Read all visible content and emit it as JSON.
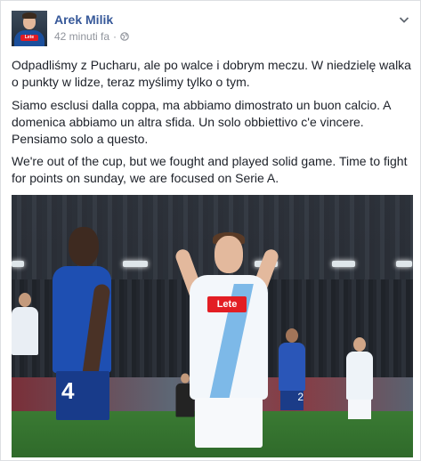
{
  "post": {
    "author": "Arek Milik",
    "time": "42 minuti fa",
    "separator": "·",
    "paragraphs": [
      "Odpadliśmy z Pucharu, ale po walce i dobrym meczu. W niedzielę walka o punkty w lidze, teraz myślimy tylko o tym.",
      "Siamo esclusi dalla coppa, ma abbiamo dimostrato un buon calcio. A domenica abbiamo un altra sfida. Un solo obbiettivo c'e vincere. Pensiamo solo a questo.",
      "We're out of the cup, but we fought and played solid game. Time to fight for points on sunday, we are focused on Serie A."
    ]
  },
  "photo": {
    "jersey_sponsor": "Lete",
    "number_blue_left": "4",
    "number_blue_right": "2"
  },
  "icons": {
    "privacy": "globe-icon",
    "menu": "chevron-down-icon"
  },
  "colors": {
    "author_link": "#365899",
    "meta_text": "#90949c",
    "body_text": "#1d2129"
  }
}
